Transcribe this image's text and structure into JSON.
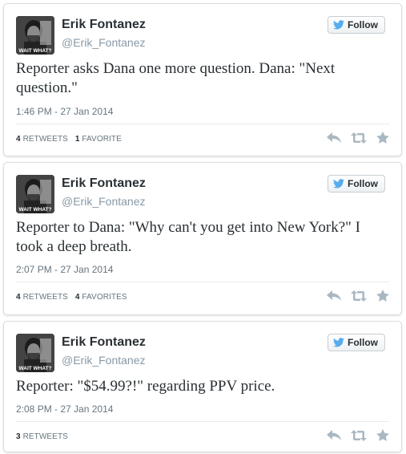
{
  "colors": {
    "bird": "#55acee",
    "text": "#292f33",
    "muted": "#8899a6",
    "action_icon": "#aab8c2"
  },
  "icons": [
    "twitter-bird-icon",
    "reply-icon",
    "retweet-icon",
    "favorite-star-icon"
  ],
  "avatar_overlay_text": "WAIT WHAT?",
  "tweets": [
    {
      "name": "Erik Fontanez",
      "handle": "@Erik_Fontanez",
      "follow_label": "Follow",
      "text": "Reporter asks Dana one more question.  Dana: \"Next question.\"",
      "time": "1:46 PM - 27 Jan 2014",
      "retweets_count": "4",
      "retweets_label": "RETWEETS",
      "favorites_count": "1",
      "favorites_label": "FAVORITE"
    },
    {
      "name": "Erik Fontanez",
      "handle": "@Erik_Fontanez",
      "follow_label": "Follow",
      "text": "Reporter to Dana: \"Why can't you get into New York?\" I took a deep breath.",
      "time": "2:07 PM - 27 Jan 2014",
      "retweets_count": "4",
      "retweets_label": "RETWEETS",
      "favorites_count": "4",
      "favorites_label": "FAVORITES"
    },
    {
      "name": "Erik Fontanez",
      "handle": "@Erik_Fontanez",
      "follow_label": "Follow",
      "text": "Reporter: \"$54.99?!\" regarding PPV price.",
      "time": "2:08 PM - 27 Jan 2014",
      "retweets_count": "3",
      "retweets_label": "RETWEETS"
    }
  ]
}
